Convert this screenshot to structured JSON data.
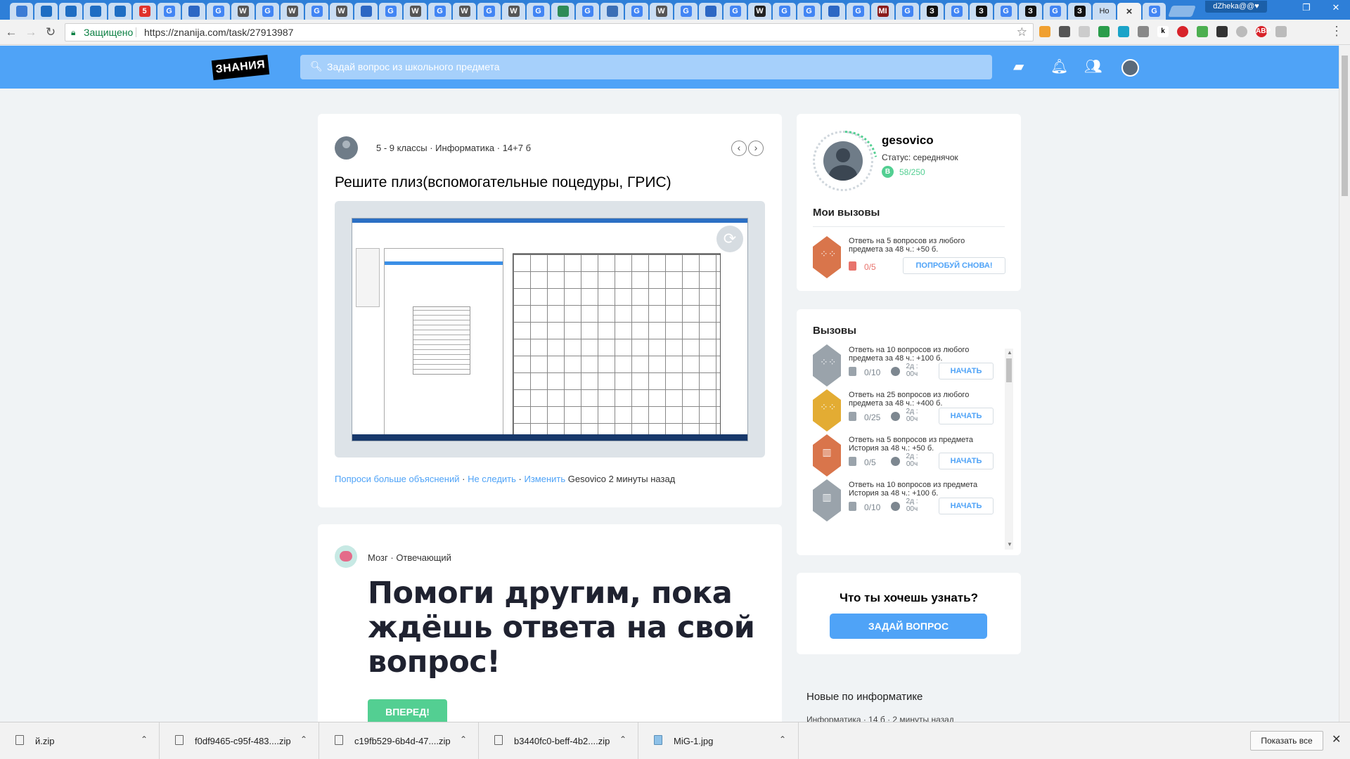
{
  "browser": {
    "tabs": [
      {
        "icon": "chat-favicon",
        "label": "",
        "color": "#3a7bd5"
      },
      {
        "icon": "mailru-favicon",
        "label": "",
        "color": "#1e6dc3"
      },
      {
        "icon": "mailru-favicon",
        "label": "",
        "color": "#1e6dc3"
      },
      {
        "icon": "mailru-favicon",
        "label": "",
        "color": "#1e6dc3"
      },
      {
        "icon": "mailru-favicon",
        "label": "",
        "color": "#1e6dc3"
      },
      {
        "icon": "five-favicon",
        "label": "5",
        "color": "#e0322b"
      },
      {
        "icon": "google-favicon",
        "label": "G",
        "color": "#4285f4"
      },
      {
        "icon": "arrow-favicon",
        "label": "",
        "color": "#2c67c4"
      },
      {
        "icon": "google-favicon",
        "label": "G",
        "color": "#4285f4"
      },
      {
        "icon": "wikipedia-favicon",
        "label": "W",
        "color": "#555555"
      },
      {
        "icon": "google-favicon",
        "label": "G",
        "color": "#4285f4"
      },
      {
        "icon": "wikipedia-favicon",
        "label": "W",
        "color": "#555555"
      },
      {
        "icon": "google-favicon",
        "label": "G",
        "color": "#4285f4"
      },
      {
        "icon": "wikipedia-favicon",
        "label": "W",
        "color": "#555555"
      },
      {
        "icon": "arrow-favicon",
        "label": "",
        "color": "#2c67c4"
      },
      {
        "icon": "google-favicon",
        "label": "G",
        "color": "#4285f4"
      },
      {
        "icon": "wikipedia-favicon",
        "label": "W",
        "color": "#555555"
      },
      {
        "icon": "google-favicon",
        "label": "G",
        "color": "#4285f4"
      },
      {
        "icon": "wikipedia-favicon",
        "label": "W",
        "color": "#555555"
      },
      {
        "icon": "google-favicon",
        "label": "G",
        "color": "#4285f4"
      },
      {
        "icon": "wikipedia-favicon",
        "label": "W",
        "color": "#555555"
      },
      {
        "icon": "google-favicon",
        "label": "G",
        "color": "#4285f4"
      },
      {
        "icon": "globe-favicon",
        "label": "",
        "color": "#2e8b57"
      },
      {
        "icon": "google-favicon",
        "label": "G",
        "color": "#4285f4"
      },
      {
        "icon": "tool-favicon",
        "label": "",
        "color": "#3b6fb6"
      },
      {
        "icon": "google-favicon",
        "label": "G",
        "color": "#4285f4"
      },
      {
        "icon": "wikipedia-favicon",
        "label": "W",
        "color": "#555555"
      },
      {
        "icon": "google-favicon",
        "label": "G",
        "color": "#4285f4"
      },
      {
        "icon": "arrow-favicon",
        "label": "",
        "color": "#2c67c4"
      },
      {
        "icon": "google-favicon",
        "label": "G",
        "color": "#4285f4"
      },
      {
        "icon": "wikipedia-favicon",
        "label": "W",
        "color": "#222222"
      },
      {
        "icon": "google-favicon",
        "label": "G",
        "color": "#4285f4"
      },
      {
        "icon": "google-favicon",
        "label": "G",
        "color": "#4285f4"
      },
      {
        "icon": "arrow-favicon",
        "label": "",
        "color": "#2c67c4"
      },
      {
        "icon": "google-favicon",
        "label": "G",
        "color": "#4285f4"
      },
      {
        "icon": "mirror-favicon",
        "label": "MI",
        "color": "#8a1c1c"
      },
      {
        "icon": "google-favicon",
        "label": "G",
        "color": "#4285f4"
      },
      {
        "icon": "znanija-favicon",
        "label": "З",
        "color": "#111111"
      },
      {
        "icon": "google-favicon",
        "label": "G",
        "color": "#4285f4"
      },
      {
        "icon": "znanija-favicon",
        "label": "З",
        "color": "#111111"
      },
      {
        "icon": "google-favicon",
        "label": "G",
        "color": "#4285f4"
      },
      {
        "icon": "znanija-favicon",
        "label": "З",
        "color": "#111111"
      },
      {
        "icon": "google-favicon",
        "label": "G",
        "color": "#4285f4"
      },
      {
        "icon": "znanija-favicon",
        "label": "З",
        "color": "#111111"
      },
      {
        "icon": "text-tab",
        "label": "Ho",
        "color": "#777777"
      },
      {
        "icon": "google-favicon",
        "label": "G",
        "color": "#4285f4"
      }
    ],
    "active_tab_close": "×",
    "last_tab_icon": "G",
    "user_badge": "dZheka@@♥",
    "security_label": "Защищено",
    "url": "https://znanija.com/task/27913987"
  },
  "site": {
    "logo_text": "ЗНАНИЯ",
    "search_placeholder": "Задай вопрос из школьного предмета"
  },
  "question": {
    "meta": "5 - 9 классы · Информатика · 14+7 б",
    "title": "Решите плиз(вспомогательные поцедуры, ГРИС)",
    "actions": {
      "ask_more": "Попроси больше объяснений",
      "unfollow": "Не следить",
      "edit": "Изменить",
      "author": "Gesovico",
      "time": "2 минуты назад"
    }
  },
  "answer_prompt": {
    "meta": "Мозг · Отвечающий",
    "headline": "Помоги другим, пока ждёшь ответа на свой вопрос!",
    "button": "ВПЕРЕД!"
  },
  "profile": {
    "username": "gesovico",
    "status": "Статус: середнячок",
    "points_badge": "B",
    "points": "58/250",
    "my_challenges_title": "Мои вызовы",
    "my_challenge": {
      "text": "Ответь на 5 вопросов из любого предмета за 48 ч.: +50 б.",
      "progress": "0/5",
      "button": "ПОПРОБУЙ СНОВА!"
    }
  },
  "challenges": {
    "title": "Вызовы",
    "items": [
      {
        "text": "Ответь на 10 вопросов из любого предмета за 48 ч.: +100 б.",
        "progress": "0/10",
        "time1": "2д :",
        "time2": "00ч",
        "button": "НАЧАТЬ",
        "gem_color": "#9aa3ab",
        "gem_icon": "grid-icon"
      },
      {
        "text": "Ответь на 25 вопросов из любого предмета за 48 ч.: +400 б.",
        "progress": "0/25",
        "time1": "2д :",
        "time2": "00ч",
        "button": "НАЧАТЬ",
        "gem_color": "#e3ac33",
        "gem_icon": "grid-icon"
      },
      {
        "text": "Ответь на 5 вопросов из предмета История за 48 ч.: +50 б.",
        "progress": "0/5",
        "time1": "2д :",
        "time2": "00ч",
        "button": "НАЧАТЬ",
        "gem_color": "#d9754b",
        "gem_icon": "column-icon"
      },
      {
        "text": "Ответь на 10 вопросов из предмета История за 48 ч.: +100 б.",
        "progress": "0/10",
        "time1": "2д :",
        "time2": "00ч",
        "button": "НАЧАТЬ",
        "gem_color": "#9aa3ab",
        "gem_icon": "column-icon"
      }
    ]
  },
  "ask_box": {
    "title": "Что ты хочешь узнать?",
    "button": "ЗАДАЙ ВОПРОС"
  },
  "new_in_subject": {
    "title": "Новые по информатике",
    "meta": "Информатика · 14 б · 2 минуты назад"
  },
  "downloads": {
    "items": [
      {
        "name": "й.zip"
      },
      {
        "name": "f0df9465-c95f-483....zip"
      },
      {
        "name": "c19fb529-6b4d-47....zip"
      },
      {
        "name": "b3440fc0-beff-4b2....zip"
      },
      {
        "name": "MiG-1.jpg"
      }
    ],
    "show_all": "Показать все",
    "close": "✕"
  }
}
